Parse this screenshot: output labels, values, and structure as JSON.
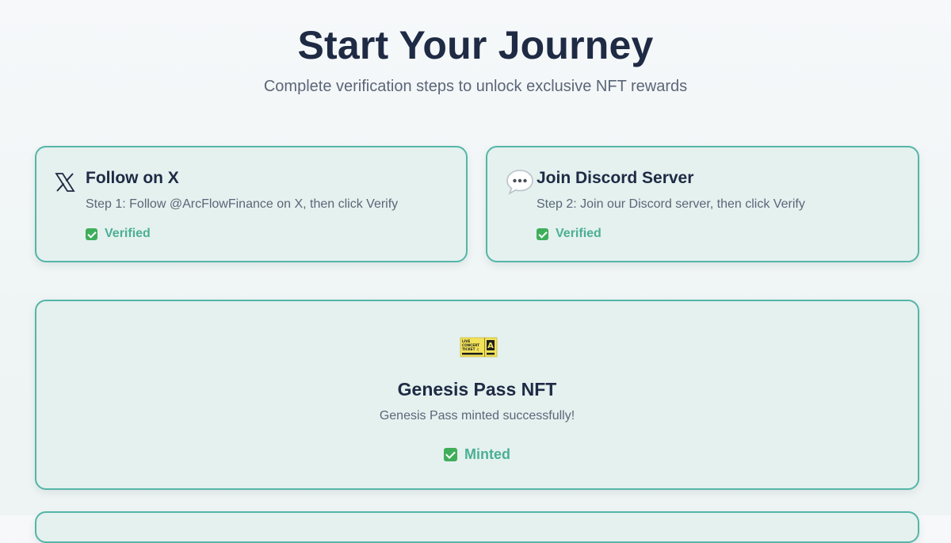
{
  "header": {
    "title": "Start Your Journey",
    "subtitle": "Complete verification steps to unlock exclusive NFT rewards"
  },
  "steps": [
    {
      "icon": "x-logo-icon",
      "title": "Follow on X",
      "description": "Step 1: Follow @ArcFlowFinance on X, then click Verify",
      "status": "Verified"
    },
    {
      "icon": "speech-bubble-icon",
      "title": "Join Discord Server",
      "description": "Step 2: Join our Discord server, then click Verify",
      "status": "Verified"
    }
  ],
  "nft": {
    "icon": "ticket-icon",
    "ticket_lines": [
      "LIVE",
      "CONCERT",
      "TICKET ♫",
      "A"
    ],
    "title": "Genesis Pass NFT",
    "description": "Genesis Pass minted successfully!",
    "status": "Minted"
  },
  "colors": {
    "accent": "#55b5a8",
    "status_text": "#4caf93",
    "check": "#3fae5a",
    "card_bg": "#e4f1ef",
    "title": "#1f2a44",
    "muted": "#5b6678"
  }
}
